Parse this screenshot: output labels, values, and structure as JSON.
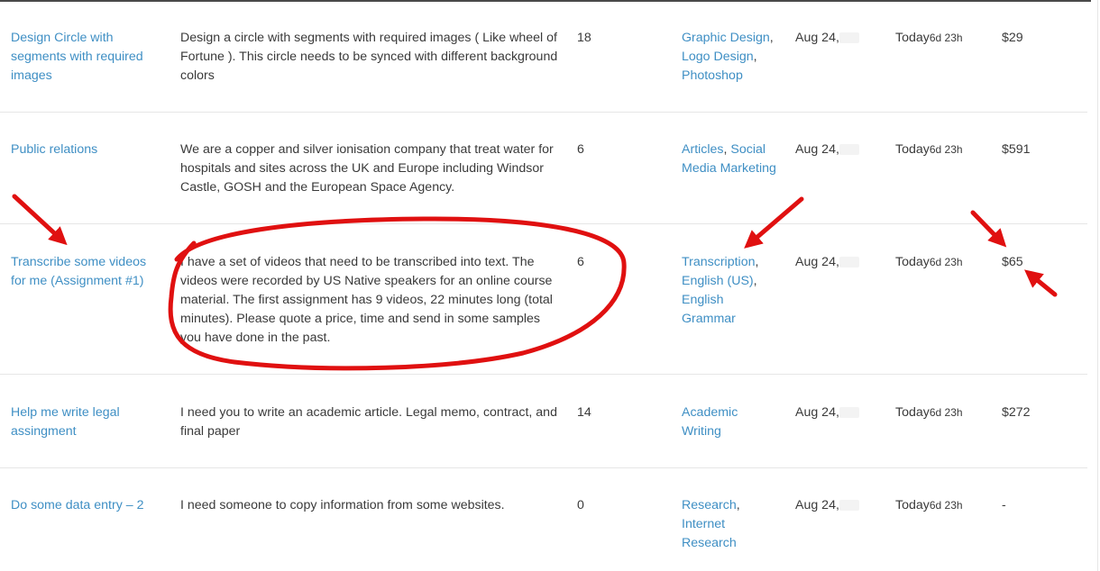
{
  "rows": [
    {
      "title": "Design Circle with segments with required images",
      "description": "Design a circle with segments with required images ( Like wheel of Fortune ). This circle needs to be synced with different background colors",
      "bids": "18",
      "skills": [
        "Graphic Design",
        "Logo Design",
        "Photoshop"
      ],
      "date": "Aug 24,",
      "time_main": "Today",
      "time_left": "6d 23h",
      "budget": "$29"
    },
    {
      "title": "Public relations",
      "description": "We are a copper and silver ionisation company that treat water for hospitals and sites across the UK and Europe including Windsor Castle, GOSH and the European Space Agency.",
      "bids": "6",
      "skills": [
        "Articles",
        "Social Media Marketing"
      ],
      "date": "Aug 24,",
      "time_main": "Today",
      "time_left": "6d 23h",
      "budget": "$591"
    },
    {
      "title": "Transcribe some videos for me (Assignment #1)",
      "description": "I have a set of videos that need to be transcribed into text. The videos were recorded by US Native speakers for an online course material. The first assignment has 9 videos, 22 minutes long (total minutes). Please quote a price, time and send in some samples you have done in the past.",
      "bids": "6",
      "skills": [
        "Transcription",
        "English (US)",
        "English Grammar"
      ],
      "date": "Aug 24,",
      "time_main": "Today",
      "time_left": "6d 23h",
      "budget": "$65"
    },
    {
      "title": "Help me write legal assingment",
      "description": "I need you to write an academic article. Legal memo, contract, and final paper",
      "bids": "14",
      "skills": [
        "Academic Writing"
      ],
      "date": "Aug 24,",
      "time_main": "Today",
      "time_left": "6d 23h",
      "budget": "$272"
    },
    {
      "title": "Do some data entry – 2",
      "description": "I need someone to copy information from some websites.",
      "bids": "0",
      "skills": [
        "Research",
        "Internet Research"
      ],
      "date": "Aug 24,",
      "time_main": "Today",
      "time_left": "6d 23h",
      "budget": "-"
    }
  ],
  "annotation_color": "#e01010"
}
